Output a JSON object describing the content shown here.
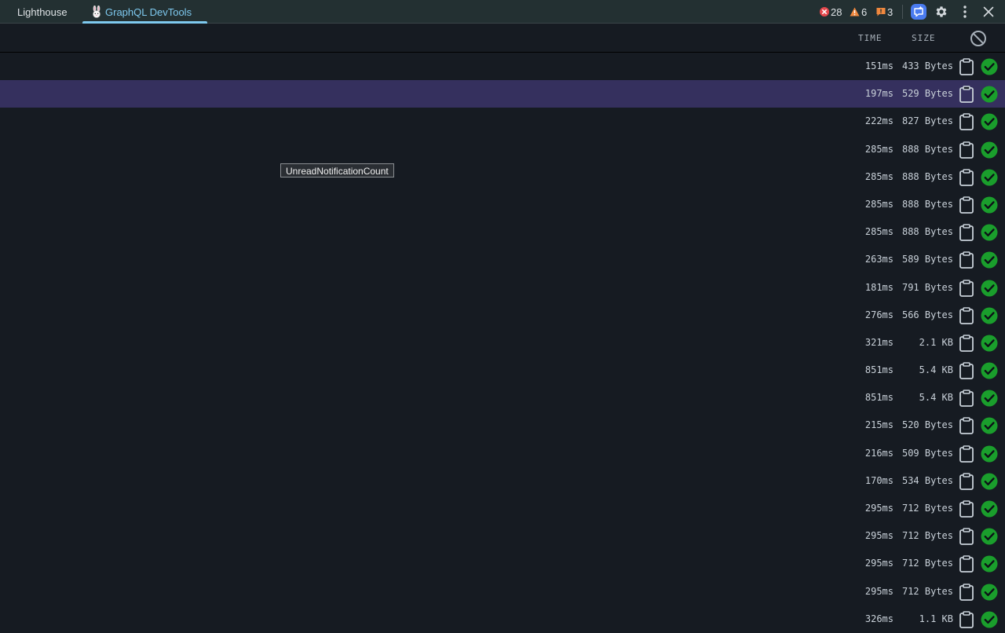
{
  "tabs": [
    {
      "label": "Lighthouse"
    },
    {
      "label": "GraphQL DevTools"
    }
  ],
  "status": {
    "errors": "28",
    "warnings": "6",
    "issues": "3"
  },
  "header": {
    "time_label": "TIME",
    "size_label": "SIZE"
  },
  "tooltip": "UnreadNotificationCount",
  "colors": {
    "selected_row": "#35305e",
    "active_tab": "#7ec9ef",
    "success": "#1a9e2c",
    "error": "#e5484d",
    "warning": "#f0883e"
  },
  "rows": [
    {
      "time": "151ms",
      "size": "433 Bytes"
    },
    {
      "time": "197ms",
      "size": "529 Bytes",
      "selected": true
    },
    {
      "time": "222ms",
      "size": "827 Bytes"
    },
    {
      "time": "285ms",
      "size": "888 Bytes"
    },
    {
      "time": "285ms",
      "size": "888 Bytes"
    },
    {
      "time": "285ms",
      "size": "888 Bytes"
    },
    {
      "time": "285ms",
      "size": "888 Bytes"
    },
    {
      "time": "263ms",
      "size": "589 Bytes"
    },
    {
      "time": "181ms",
      "size": "791 Bytes"
    },
    {
      "time": "276ms",
      "size": "566 Bytes"
    },
    {
      "time": "321ms",
      "size": "2.1 KB"
    },
    {
      "time": "851ms",
      "size": "5.4 KB"
    },
    {
      "time": "851ms",
      "size": "5.4 KB"
    },
    {
      "time": "215ms",
      "size": "520 Bytes"
    },
    {
      "time": "216ms",
      "size": "509 Bytes"
    },
    {
      "time": "170ms",
      "size": "534 Bytes"
    },
    {
      "time": "295ms",
      "size": "712 Bytes"
    },
    {
      "time": "295ms",
      "size": "712 Bytes"
    },
    {
      "time": "295ms",
      "size": "712 Bytes"
    },
    {
      "time": "295ms",
      "size": "712 Bytes"
    },
    {
      "time": "326ms",
      "size": "1.1 KB"
    }
  ]
}
